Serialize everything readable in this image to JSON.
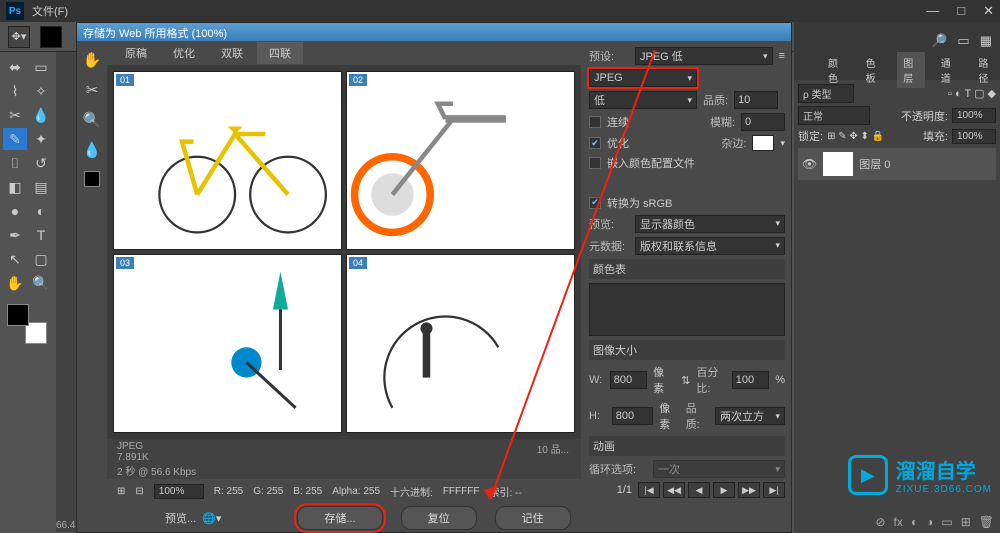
{
  "menubar": {
    "ps": "Ps",
    "file": "文件(F)"
  },
  "win_controls": {
    "min": "—",
    "max": "□",
    "close": "✕"
  },
  "dialog": {
    "title": "存储为 Web 所用格式 (100%)",
    "tabs": [
      "原稿",
      "优化",
      "双联",
      "四联"
    ],
    "active_tab": 3,
    "panes": [
      "01",
      "02",
      "03",
      "04"
    ],
    "info": {
      "format": "JPEG",
      "size": "7.891K",
      "speed": "2 秒 @ 56.6 Kbps",
      "quality_note": "10 品..."
    },
    "bottombar": {
      "zoom": "100%",
      "r": "R: 255",
      "g": "G: 255",
      "b": "B: 255",
      "alpha": "Alpha: 255",
      "hex_label": "十六进制:",
      "hex": "FFFFFF",
      "index": "索引: --"
    },
    "buttons": {
      "save": "存储...",
      "reset": "复位",
      "remember": "记住",
      "preview_label": "预览..."
    }
  },
  "settings": {
    "preset_label": "预设:",
    "preset_value": "JPEG 低",
    "format": "JPEG",
    "quality_preset": "低",
    "quality_label": "品质:",
    "quality_value": "10",
    "progressive": "连续",
    "blur_label": "模糊:",
    "blur_value": "0",
    "optimized": "优化",
    "matte_label": "杂边:",
    "embed_profile": "嵌入颜色配置文件",
    "convert_srgb": "转换为 sRGB",
    "preview_label": "预览:",
    "preview_value": "显示器颜色",
    "metadata_label": "元数据:",
    "metadata_value": "版权和联系信息",
    "colortable": "颜色表",
    "imagesize": {
      "title": "图像大小",
      "w_label": "W:",
      "w": "800",
      "h_label": "H:",
      "h": "800",
      "px": "像素",
      "percent_label": "百分比:",
      "percent": "100",
      "pct": "%",
      "quality_label": "品质:",
      "quality": "两次立方"
    },
    "animation": {
      "title": "动画",
      "loop_label": "循环选项:",
      "loop_value": "一次",
      "frame": "1/1",
      "buttons": [
        "|◀",
        "◀◀",
        "◀",
        "▶",
        "▶▶",
        "▶|"
      ]
    }
  },
  "rightpanel": {
    "tabs": [
      "颜色",
      "色板",
      "图层",
      "通道",
      "路径"
    ],
    "active": 2,
    "kind_label": "ρ 类型",
    "blend": "正常",
    "opacity_label": "不透明度:",
    "opacity": "100%",
    "lock_label": "锁定:",
    "fill_label": "填充:",
    "fill": "100%",
    "layer_name": "图层 0"
  },
  "statusbar": {
    "zoom": "66.4"
  },
  "watermark": {
    "title": "溜溜自学",
    "sub": "ZIXUE.3D66.COM"
  }
}
